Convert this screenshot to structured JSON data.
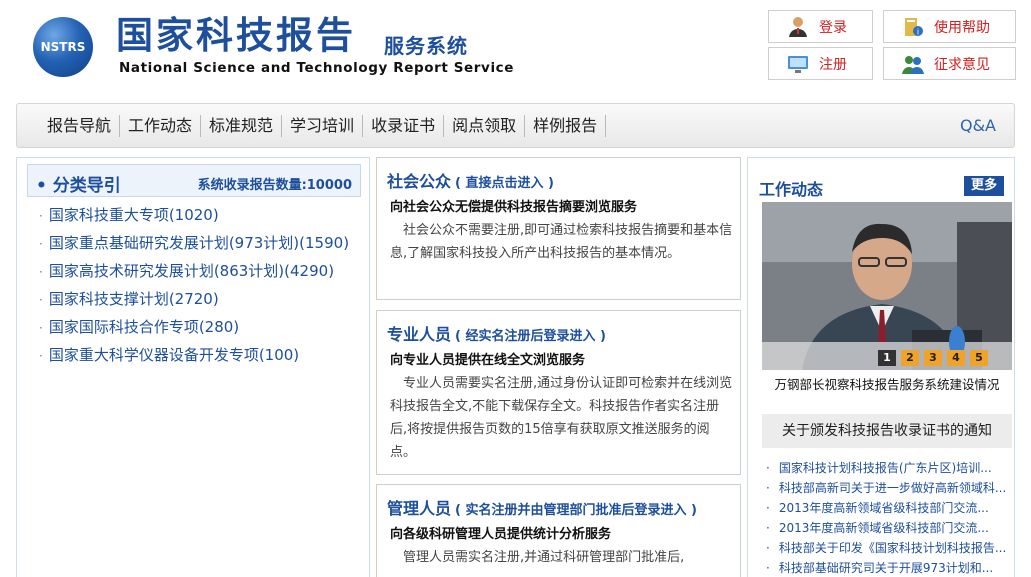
{
  "header": {
    "logo_text": "NSTRS",
    "title": "国家科技报告",
    "subtitle": "服务系统",
    "english": "National Science and Technology Report Service",
    "buttons": {
      "login": "登录",
      "help": "使用帮助",
      "register": "注册",
      "feedback": "征求意见"
    }
  },
  "nav": {
    "items": [
      "报告导航",
      "工作动态",
      "标准规范",
      "学习培训",
      "收录证书",
      "阅点领取",
      "样例报告"
    ],
    "qa": "Q&A"
  },
  "left": {
    "title": "分类导引",
    "count_label": "系统收录报告数量:10000",
    "items": [
      "国家科技重大专项(1020)",
      "国家重点基础研究发展计划(973计划)(1590)",
      "国家高技术研究发展计划(863计划)(4290)",
      "国家科技支撑计划(2720)",
      "国家国际科技合作专项(280)",
      "国家重大科学仪器设备开发专项(100)"
    ]
  },
  "middle": {
    "public": {
      "title": "社会公众",
      "hint": "( 直接点击进入 )",
      "sub": "向社会公众无偿提供科技报告摘要浏览服务",
      "desc": "社会公众不需要注册,即可通过检索科技报告摘要和基本信息,了解国家科技投入所产出科技报告的基本情况。"
    },
    "pro": {
      "title": "专业人员",
      "hint": "( 经实名注册后登录进入 )",
      "sub": "向专业人员提供在线全文浏览服务",
      "desc": "专业人员需要实名注册,通过身份认证即可检索并在线浏览科技报告全文,不能下载保存全文。科技报告作者实名注册后,将按提供报告页数的15倍享有获取原文推送服务的阅点。"
    },
    "admin": {
      "title": "管理人员",
      "hint": "( 实名注册并由管理部门批准后登录进入 )",
      "sub": "向各级科研管理人员提供统计分析服务",
      "desc": "管理人员需实名注册,并通过科研管理部门批准后,"
    }
  },
  "right": {
    "title": "工作动态",
    "more": "更多",
    "pager": [
      "1",
      "2",
      "3",
      "4",
      "5"
    ],
    "caption": "万钢部长视察科技报告服务系统建设情况",
    "notice": "关于颁发科技报告收录证书的通知",
    "news": [
      "国家科技计划科技报告(广东片区)培训...",
      "科技部高新司关于进一步做好高新领域科...",
      "2013年度高新领域省级科技部门交流...",
      "2013年度高新领域省级科技部门交流...",
      "科技部关于印发《国家科技计划科技报告...",
      "科技部基础研究司关于开展973计划和..."
    ]
  }
}
